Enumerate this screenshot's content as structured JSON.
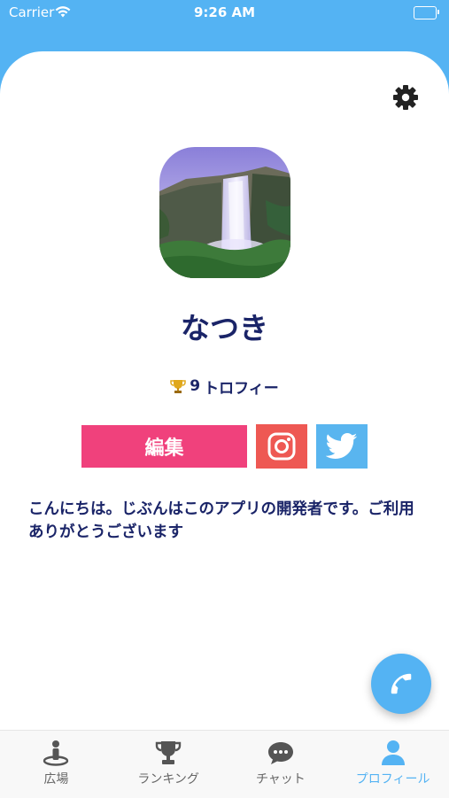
{
  "status_bar": {
    "carrier": "Carrier",
    "time": "9:26 AM"
  },
  "profile": {
    "name": "なつき",
    "trophy_count": "9",
    "trophy_label": "トロフィー",
    "bio": "こんにちは。じぶんはこのアプリの開発者です。ご利用ありがとうございます"
  },
  "actions": {
    "edit_label": "編集"
  },
  "tabs": [
    {
      "label": "広場",
      "icon": "plaza-icon",
      "active": false
    },
    {
      "label": "ランキング",
      "icon": "trophy-icon",
      "active": false
    },
    {
      "label": "チャット",
      "icon": "chat-icon",
      "active": false
    },
    {
      "label": "プロフィール",
      "icon": "user-icon",
      "active": true
    }
  ],
  "colors": {
    "accent": "#54b3f3",
    "edit": "#f0417c",
    "instagram": "#ee5853",
    "twitter": "#59b5ef",
    "text": "#1a2468"
  }
}
